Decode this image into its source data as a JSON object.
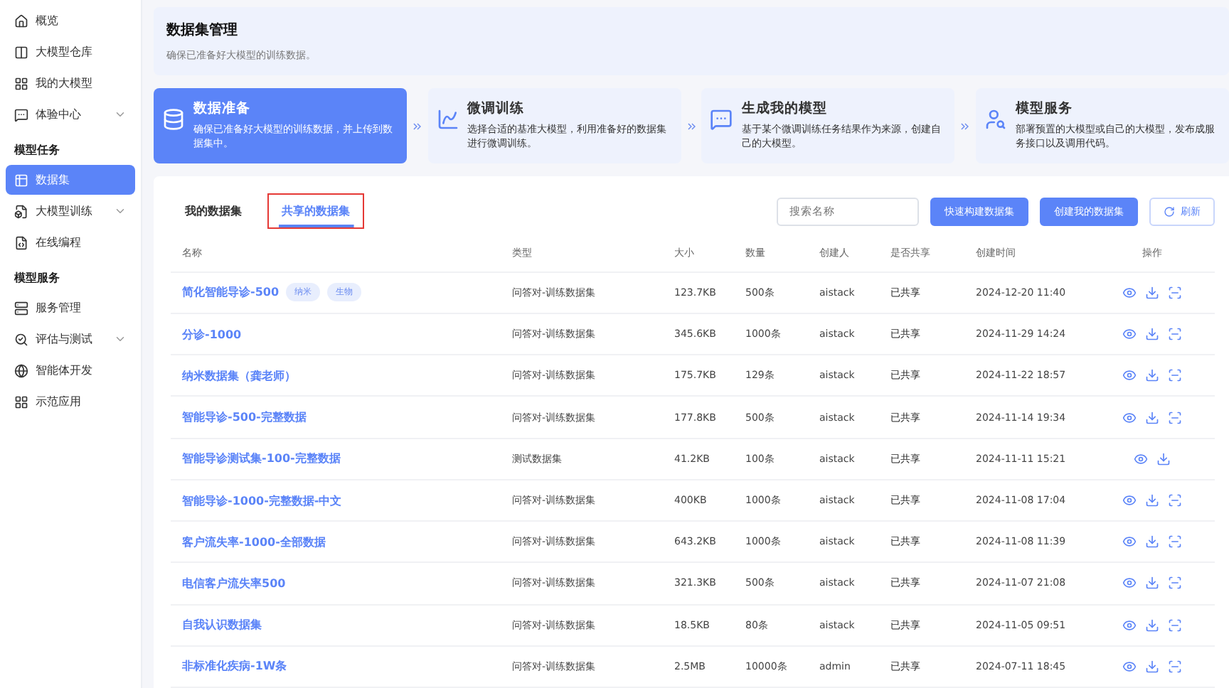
{
  "sidebar": {
    "sections": [
      {
        "items": [
          {
            "label": "概览",
            "expandable": false,
            "selected": false
          },
          {
            "label": "大模型仓库",
            "expandable": false,
            "selected": false
          },
          {
            "label": "我的大模型",
            "expandable": false,
            "selected": false
          },
          {
            "label": "体验中心",
            "expandable": true,
            "selected": false
          }
        ]
      },
      {
        "title": "模型任务",
        "items": [
          {
            "label": "数据集",
            "expandable": false,
            "selected": true
          },
          {
            "label": "大模型训练",
            "expandable": true,
            "selected": false
          },
          {
            "label": "在线编程",
            "expandable": false,
            "selected": false
          }
        ]
      },
      {
        "title": "模型服务",
        "items": [
          {
            "label": "服务管理",
            "expandable": false,
            "selected": false
          },
          {
            "label": "评估与测试",
            "expandable": true,
            "selected": false
          },
          {
            "label": "智能体开发",
            "expandable": false,
            "selected": false
          },
          {
            "label": "示范应用",
            "expandable": false,
            "selected": false
          }
        ]
      }
    ]
  },
  "header": {
    "title": "数据集管理",
    "subtitle": "确保已准备好大模型的训练数据。"
  },
  "steps": [
    {
      "title": "数据准备",
      "desc": "确保已准备好大模型的训练数据，并上传到数据集中。",
      "selected": true
    },
    {
      "title": "微调训练",
      "desc": "选择合适的基准大模型，利用准备好的数据集进行微调训练。",
      "selected": false
    },
    {
      "title": "生成我的模型",
      "desc": "基于某个微调训练任务结果作为来源，创建自己的大模型。",
      "selected": false
    },
    {
      "title": "模型服务",
      "desc": "部署预置的大模型或自己的大模型，发布成服务接口以及调用代码。",
      "selected": false
    }
  ],
  "tabs": [
    {
      "label": "我的数据集",
      "selected": false,
      "annotated": false
    },
    {
      "label": "共享的数据集",
      "selected": true,
      "annotated": true
    }
  ],
  "search": {
    "placeholder": "搜索名称"
  },
  "buttons": [
    {
      "label": "快速构建数据集",
      "kind": "primary"
    },
    {
      "label": "创建我的数据集",
      "kind": "primary"
    },
    {
      "label": "刷新",
      "kind": "refresh"
    }
  ],
  "table": {
    "columns": [
      "名称",
      "类型",
      "大小",
      "数量",
      "创建人",
      "是否共享",
      "创建时间",
      "操作"
    ],
    "rows": [
      {
        "name": "简化智能导诊-500",
        "tags": [
          "纳米",
          "生物"
        ],
        "type": "问答对-训练数据集",
        "size": "123.7KB",
        "count": "500条",
        "creator": "aistack",
        "shared": "已共享",
        "time": "2024-12-20 11:40",
        "config_action": true
      },
      {
        "name": "分诊-1000",
        "type": "问答对-训练数据集",
        "size": "345.6KB",
        "count": "1000条",
        "creator": "aistack",
        "shared": "已共享",
        "time": "2024-11-29 14:24",
        "config_action": true
      },
      {
        "name": "纳米数据集（龚老师）",
        "type": "问答对-训练数据集",
        "size": "175.7KB",
        "count": "129条",
        "creator": "aistack",
        "shared": "已共享",
        "time": "2024-11-22 18:57",
        "config_action": true
      },
      {
        "name": "智能导诊-500-完整数据",
        "type": "问答对-训练数据集",
        "size": "177.8KB",
        "count": "500条",
        "creator": "aistack",
        "shared": "已共享",
        "time": "2024-11-14 19:34",
        "config_action": true
      },
      {
        "name": "智能导诊测试集-100-完整数据",
        "type": "测试数据集",
        "size": "41.2KB",
        "count": "100条",
        "creator": "aistack",
        "shared": "已共享",
        "time": "2024-11-11 15:21",
        "config_action": false
      },
      {
        "name": "智能导诊-1000-完整数据-中文",
        "type": "问答对-训练数据集",
        "size": "400KB",
        "count": "1000条",
        "creator": "aistack",
        "shared": "已共享",
        "time": "2024-11-08 17:04",
        "config_action": true
      },
      {
        "name": "客户流失率-1000-全部数据",
        "type": "问答对-训练数据集",
        "size": "643.2KB",
        "count": "1000条",
        "creator": "aistack",
        "shared": "已共享",
        "time": "2024-11-08 11:39",
        "config_action": true
      },
      {
        "name": "电信客户流失率500",
        "type": "问答对-训练数据集",
        "size": "321.3KB",
        "count": "500条",
        "creator": "aistack",
        "shared": "已共享",
        "time": "2024-11-07 21:08",
        "config_action": true
      },
      {
        "name": "自我认识数据集",
        "type": "问答对-训练数据集",
        "size": "18.5KB",
        "count": "80条",
        "creator": "aistack",
        "shared": "已共享",
        "time": "2024-11-05 09:51",
        "config_action": true
      },
      {
        "name": "非标准化疾病-1W条",
        "type": "问答对-训练数据集",
        "size": "2.5MB",
        "count": "10000条",
        "creator": "admin",
        "shared": "已共享",
        "time": "2024-07-11 18:45",
        "config_action": true
      }
    ]
  }
}
